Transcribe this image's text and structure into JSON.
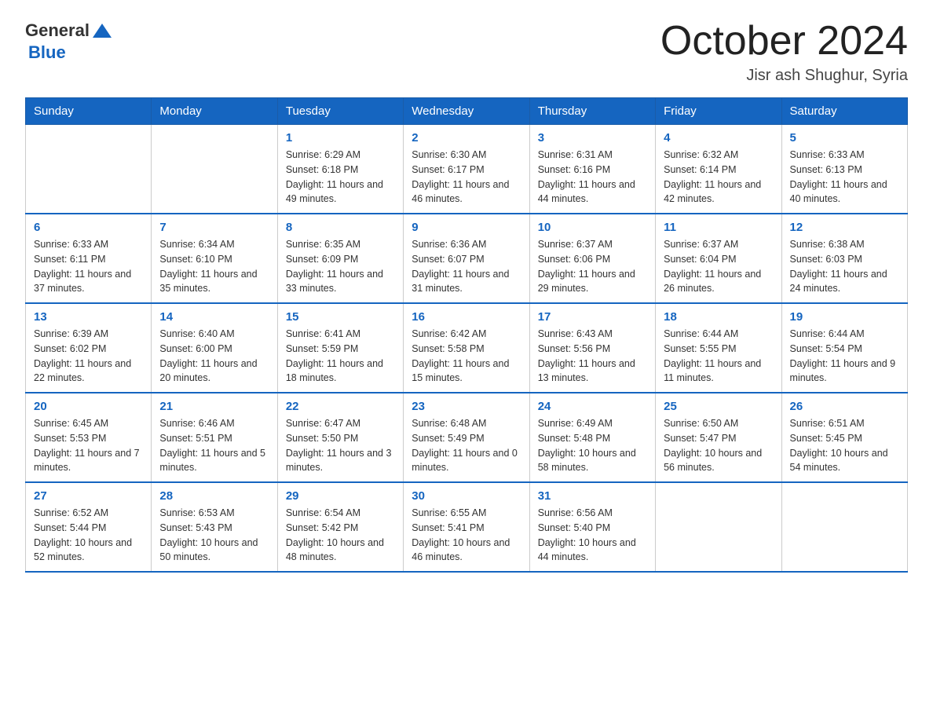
{
  "header": {
    "logo_general": "General",
    "logo_blue": "Blue",
    "title": "October 2024",
    "subtitle": "Jisr ash Shughur, Syria"
  },
  "weekdays": [
    "Sunday",
    "Monday",
    "Tuesday",
    "Wednesday",
    "Thursday",
    "Friday",
    "Saturday"
  ],
  "weeks": [
    [
      {
        "day": "",
        "sunrise": "",
        "sunset": "",
        "daylight": ""
      },
      {
        "day": "",
        "sunrise": "",
        "sunset": "",
        "daylight": ""
      },
      {
        "day": "1",
        "sunrise": "Sunrise: 6:29 AM",
        "sunset": "Sunset: 6:18 PM",
        "daylight": "Daylight: 11 hours and 49 minutes."
      },
      {
        "day": "2",
        "sunrise": "Sunrise: 6:30 AM",
        "sunset": "Sunset: 6:17 PM",
        "daylight": "Daylight: 11 hours and 46 minutes."
      },
      {
        "day": "3",
        "sunrise": "Sunrise: 6:31 AM",
        "sunset": "Sunset: 6:16 PM",
        "daylight": "Daylight: 11 hours and 44 minutes."
      },
      {
        "day": "4",
        "sunrise": "Sunrise: 6:32 AM",
        "sunset": "Sunset: 6:14 PM",
        "daylight": "Daylight: 11 hours and 42 minutes."
      },
      {
        "day": "5",
        "sunrise": "Sunrise: 6:33 AM",
        "sunset": "Sunset: 6:13 PM",
        "daylight": "Daylight: 11 hours and 40 minutes."
      }
    ],
    [
      {
        "day": "6",
        "sunrise": "Sunrise: 6:33 AM",
        "sunset": "Sunset: 6:11 PM",
        "daylight": "Daylight: 11 hours and 37 minutes."
      },
      {
        "day": "7",
        "sunrise": "Sunrise: 6:34 AM",
        "sunset": "Sunset: 6:10 PM",
        "daylight": "Daylight: 11 hours and 35 minutes."
      },
      {
        "day": "8",
        "sunrise": "Sunrise: 6:35 AM",
        "sunset": "Sunset: 6:09 PM",
        "daylight": "Daylight: 11 hours and 33 minutes."
      },
      {
        "day": "9",
        "sunrise": "Sunrise: 6:36 AM",
        "sunset": "Sunset: 6:07 PM",
        "daylight": "Daylight: 11 hours and 31 minutes."
      },
      {
        "day": "10",
        "sunrise": "Sunrise: 6:37 AM",
        "sunset": "Sunset: 6:06 PM",
        "daylight": "Daylight: 11 hours and 29 minutes."
      },
      {
        "day": "11",
        "sunrise": "Sunrise: 6:37 AM",
        "sunset": "Sunset: 6:04 PM",
        "daylight": "Daylight: 11 hours and 26 minutes."
      },
      {
        "day": "12",
        "sunrise": "Sunrise: 6:38 AM",
        "sunset": "Sunset: 6:03 PM",
        "daylight": "Daylight: 11 hours and 24 minutes."
      }
    ],
    [
      {
        "day": "13",
        "sunrise": "Sunrise: 6:39 AM",
        "sunset": "Sunset: 6:02 PM",
        "daylight": "Daylight: 11 hours and 22 minutes."
      },
      {
        "day": "14",
        "sunrise": "Sunrise: 6:40 AM",
        "sunset": "Sunset: 6:00 PM",
        "daylight": "Daylight: 11 hours and 20 minutes."
      },
      {
        "day": "15",
        "sunrise": "Sunrise: 6:41 AM",
        "sunset": "Sunset: 5:59 PM",
        "daylight": "Daylight: 11 hours and 18 minutes."
      },
      {
        "day": "16",
        "sunrise": "Sunrise: 6:42 AM",
        "sunset": "Sunset: 5:58 PM",
        "daylight": "Daylight: 11 hours and 15 minutes."
      },
      {
        "day": "17",
        "sunrise": "Sunrise: 6:43 AM",
        "sunset": "Sunset: 5:56 PM",
        "daylight": "Daylight: 11 hours and 13 minutes."
      },
      {
        "day": "18",
        "sunrise": "Sunrise: 6:44 AM",
        "sunset": "Sunset: 5:55 PM",
        "daylight": "Daylight: 11 hours and 11 minutes."
      },
      {
        "day": "19",
        "sunrise": "Sunrise: 6:44 AM",
        "sunset": "Sunset: 5:54 PM",
        "daylight": "Daylight: 11 hours and 9 minutes."
      }
    ],
    [
      {
        "day": "20",
        "sunrise": "Sunrise: 6:45 AM",
        "sunset": "Sunset: 5:53 PM",
        "daylight": "Daylight: 11 hours and 7 minutes."
      },
      {
        "day": "21",
        "sunrise": "Sunrise: 6:46 AM",
        "sunset": "Sunset: 5:51 PM",
        "daylight": "Daylight: 11 hours and 5 minutes."
      },
      {
        "day": "22",
        "sunrise": "Sunrise: 6:47 AM",
        "sunset": "Sunset: 5:50 PM",
        "daylight": "Daylight: 11 hours and 3 minutes."
      },
      {
        "day": "23",
        "sunrise": "Sunrise: 6:48 AM",
        "sunset": "Sunset: 5:49 PM",
        "daylight": "Daylight: 11 hours and 0 minutes."
      },
      {
        "day": "24",
        "sunrise": "Sunrise: 6:49 AM",
        "sunset": "Sunset: 5:48 PM",
        "daylight": "Daylight: 10 hours and 58 minutes."
      },
      {
        "day": "25",
        "sunrise": "Sunrise: 6:50 AM",
        "sunset": "Sunset: 5:47 PM",
        "daylight": "Daylight: 10 hours and 56 minutes."
      },
      {
        "day": "26",
        "sunrise": "Sunrise: 6:51 AM",
        "sunset": "Sunset: 5:45 PM",
        "daylight": "Daylight: 10 hours and 54 minutes."
      }
    ],
    [
      {
        "day": "27",
        "sunrise": "Sunrise: 6:52 AM",
        "sunset": "Sunset: 5:44 PM",
        "daylight": "Daylight: 10 hours and 52 minutes."
      },
      {
        "day": "28",
        "sunrise": "Sunrise: 6:53 AM",
        "sunset": "Sunset: 5:43 PM",
        "daylight": "Daylight: 10 hours and 50 minutes."
      },
      {
        "day": "29",
        "sunrise": "Sunrise: 6:54 AM",
        "sunset": "Sunset: 5:42 PM",
        "daylight": "Daylight: 10 hours and 48 minutes."
      },
      {
        "day": "30",
        "sunrise": "Sunrise: 6:55 AM",
        "sunset": "Sunset: 5:41 PM",
        "daylight": "Daylight: 10 hours and 46 minutes."
      },
      {
        "day": "31",
        "sunrise": "Sunrise: 6:56 AM",
        "sunset": "Sunset: 5:40 PM",
        "daylight": "Daylight: 10 hours and 44 minutes."
      },
      {
        "day": "",
        "sunrise": "",
        "sunset": "",
        "daylight": ""
      },
      {
        "day": "",
        "sunrise": "",
        "sunset": "",
        "daylight": ""
      }
    ]
  ]
}
